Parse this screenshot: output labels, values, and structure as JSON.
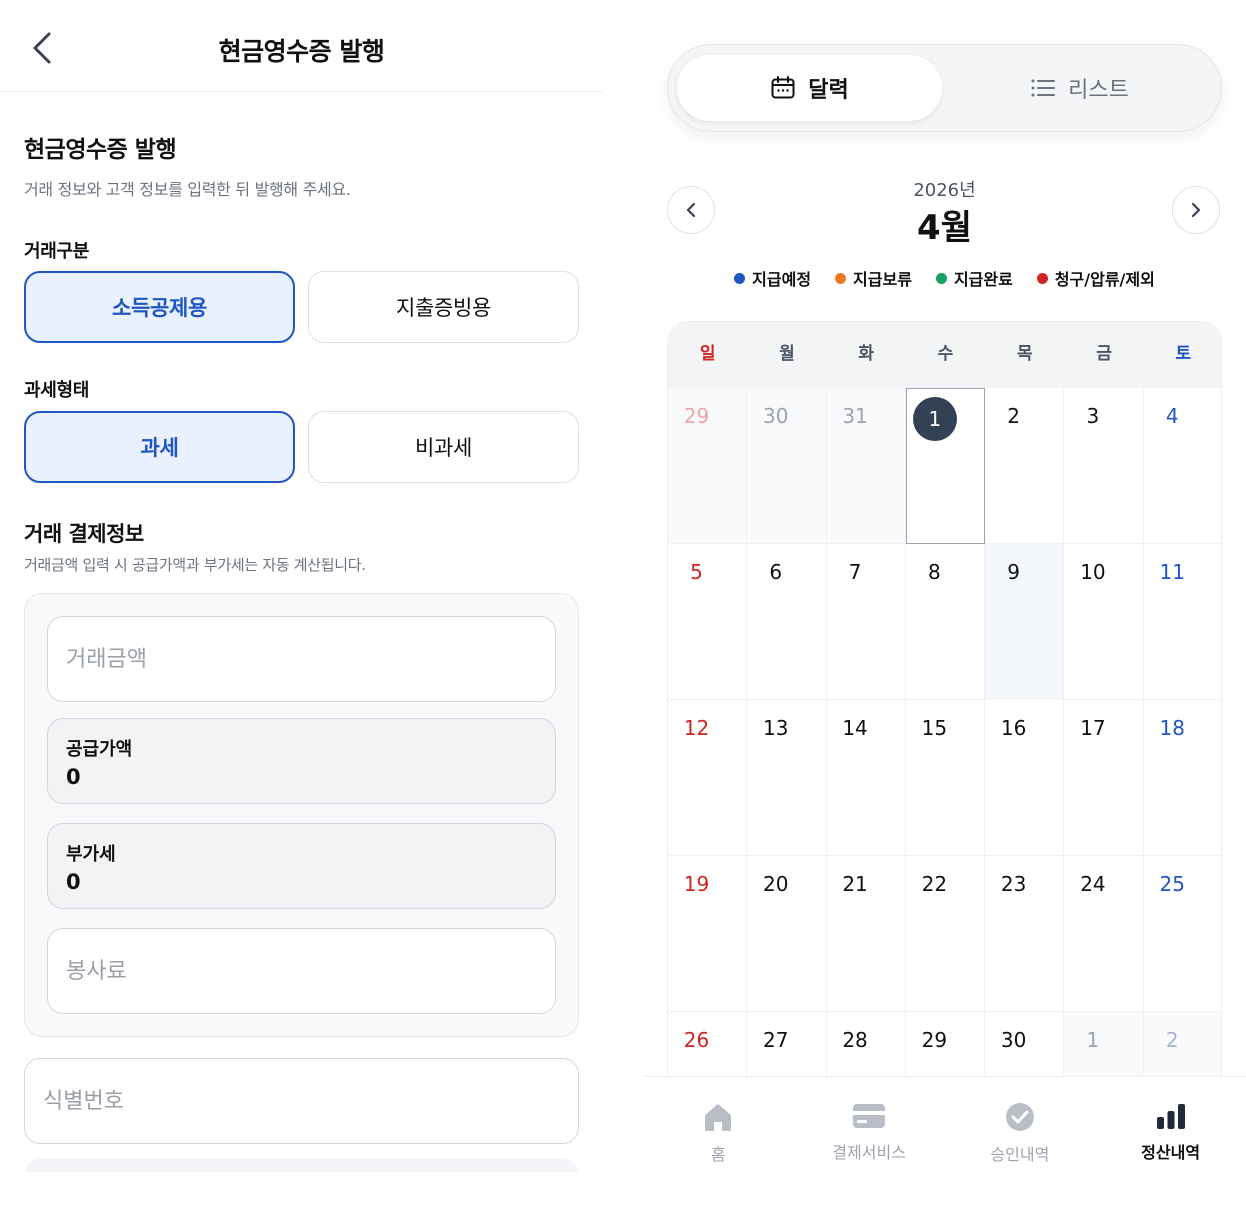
{
  "receipt": {
    "header_title": "현금영수증 발행",
    "section_title": "현금영수증 발행",
    "section_desc": "거래 정보와 고객 정보를 입력한 뒤 발행해 주세요.",
    "trade_type": {
      "label": "거래구분",
      "options": [
        "소득공제용",
        "지출증빙용"
      ],
      "selected": "소득공제용"
    },
    "tax_type": {
      "label": "과세형태",
      "options": [
        "과세",
        "비과세"
      ],
      "selected": "과세"
    },
    "payment": {
      "title": "거래 결제정보",
      "desc": "거래금액 입력 시 공급가액과 부가세는 자동 계산됩니다.",
      "amount_placeholder": "거래금액",
      "supply_label": "공급가액",
      "supply_value": "0",
      "vat_label": "부가세",
      "vat_value": "0",
      "service_placeholder": "봉사료"
    },
    "id_placeholder": "식별번호"
  },
  "settlement": {
    "view_toggle": {
      "calendar_label": "달력",
      "list_label": "리스트",
      "selected": "calendar"
    },
    "year_label": "2026년",
    "month_label": "4월",
    "legend": [
      {
        "label": "지급예정",
        "color": "#1f56c3"
      },
      {
        "label": "지급보류",
        "color": "#f07a1f"
      },
      {
        "label": "지급완료",
        "color": "#16a063"
      },
      {
        "label": "청구/압류/제외",
        "color": "#d32323"
      }
    ],
    "weekdays": [
      "일",
      "월",
      "화",
      "수",
      "목",
      "금",
      "토"
    ],
    "weeks": [
      [
        "29",
        "30",
        "31",
        "1",
        "2",
        "3",
        "4"
      ],
      [
        "5",
        "6",
        "7",
        "8",
        "9",
        "10",
        "11"
      ],
      [
        "12",
        "13",
        "14",
        "15",
        "16",
        "17",
        "18"
      ],
      [
        "19",
        "20",
        "21",
        "22",
        "23",
        "24",
        "25"
      ],
      [
        "26",
        "27",
        "28",
        "29",
        "30",
        "1",
        "2"
      ]
    ],
    "today": "1",
    "tabs": [
      {
        "label": "홈",
        "icon": "home-icon"
      },
      {
        "label": "결제서비스",
        "icon": "card-icon"
      },
      {
        "label": "승인내역",
        "icon": "check-circle-icon"
      },
      {
        "label": "정산내역",
        "icon": "bar-chart-icon",
        "active": true
      }
    ]
  }
}
